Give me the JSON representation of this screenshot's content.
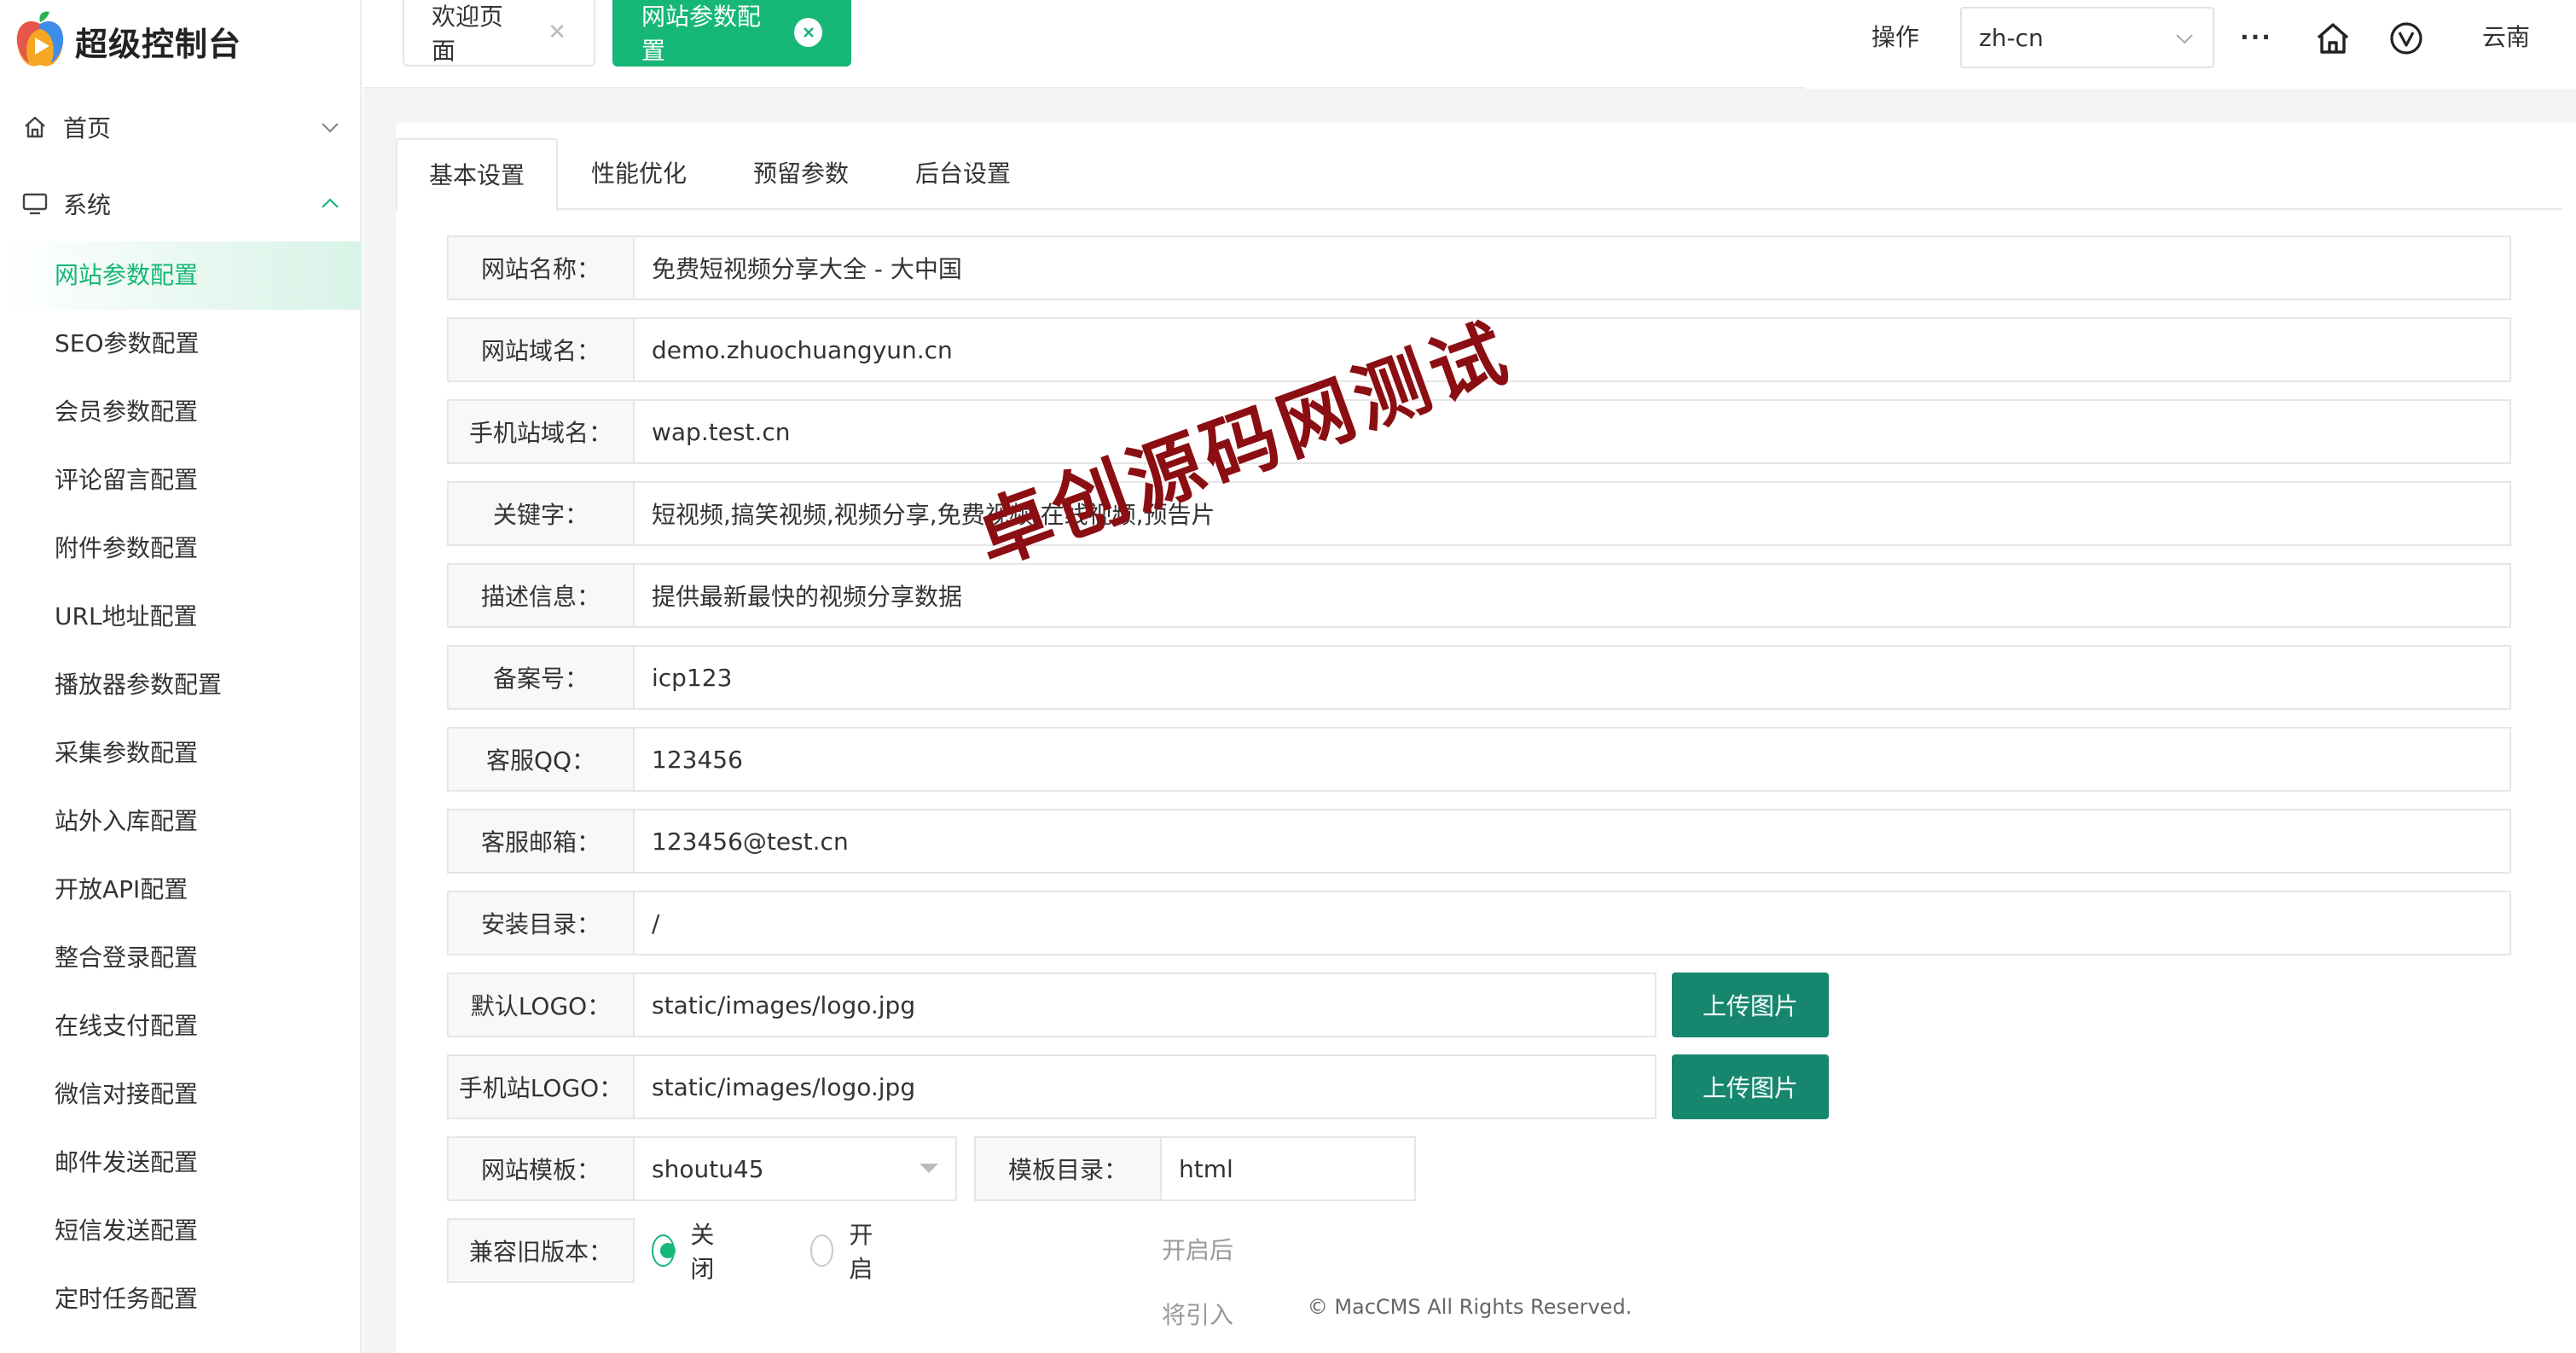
{
  "app": {
    "title": "超级控制台"
  },
  "sidebar": {
    "groups": [
      {
        "label": "首页",
        "icon": "home-icon",
        "expanded": false
      },
      {
        "label": "系统",
        "icon": "monitor-icon",
        "expanded": true
      }
    ],
    "items": [
      {
        "label": "网站参数配置",
        "active": true
      },
      {
        "label": "SEO参数配置"
      },
      {
        "label": "会员参数配置"
      },
      {
        "label": "评论留言配置"
      },
      {
        "label": "附件参数配置"
      },
      {
        "label": "URL地址配置"
      },
      {
        "label": "播放器参数配置"
      },
      {
        "label": "采集参数配置"
      },
      {
        "label": "站外入库配置"
      },
      {
        "label": "开放API配置"
      },
      {
        "label": "整合登录配置"
      },
      {
        "label": "在线支付配置"
      },
      {
        "label": "微信对接配置"
      },
      {
        "label": "邮件发送配置"
      },
      {
        "label": "短信发送配置"
      },
      {
        "label": "定时任务配置"
      }
    ]
  },
  "page_tabs": [
    {
      "label": "欢迎页面",
      "active": false
    },
    {
      "label": "网站参数配置",
      "active": true
    }
  ],
  "header_right": {
    "operate": "操作",
    "language": "zh-cn",
    "more": "···",
    "user": "云南"
  },
  "sub_tabs": [
    {
      "label": "基本设置",
      "active": true
    },
    {
      "label": "性能优化"
    },
    {
      "label": "预留参数"
    },
    {
      "label": "后台设置"
    }
  ],
  "form": {
    "site_name": {
      "label": "网站名称：",
      "value": "免费短视频分享大全 - 大中国"
    },
    "site_domain": {
      "label": "网站域名：",
      "value": "demo.zhuochuangyun.cn"
    },
    "mobile_domain": {
      "label": "手机站域名：",
      "value": "wap.test.cn"
    },
    "keywords": {
      "label": "关键字：",
      "value": "短视频,搞笑视频,视频分享,免费视频,在线视频,预告片"
    },
    "description": {
      "label": "描述信息：",
      "value": "提供最新最快的视频分享数据"
    },
    "icp": {
      "label": "备案号：",
      "value": "icp123"
    },
    "qq": {
      "label": "客服QQ：",
      "value": "123456"
    },
    "email": {
      "label": "客服邮箱：",
      "value": "123456@test.cn"
    },
    "install_dir": {
      "label": "安装目录：",
      "value": "/"
    },
    "default_logo": {
      "label": "默认LOGO：",
      "value": "static/images/logo.jpg",
      "button": "上传图片"
    },
    "mobile_logo": {
      "label": "手机站LOGO：",
      "value": "static/images/logo.jpg",
      "button": "上传图片"
    },
    "template": {
      "label": "网站模板：",
      "value": "shoutu45"
    },
    "template_dir": {
      "label": "模板目录：",
      "value": "html"
    },
    "compat": {
      "label": "兼容旧版本：",
      "options": [
        {
          "label": "关闭",
          "checked": true
        },
        {
          "label": "开启",
          "checked": false
        }
      ],
      "hint": "开启后将引入polyfill兼容旧版本浏览器"
    }
  },
  "footer": "© MacCMS All Rights Reserved.",
  "watermark": "卓创源码网测试",
  "colors": {
    "accent": "#16b777",
    "upload_button": "#16876e",
    "watermark": "#8b0e12"
  }
}
